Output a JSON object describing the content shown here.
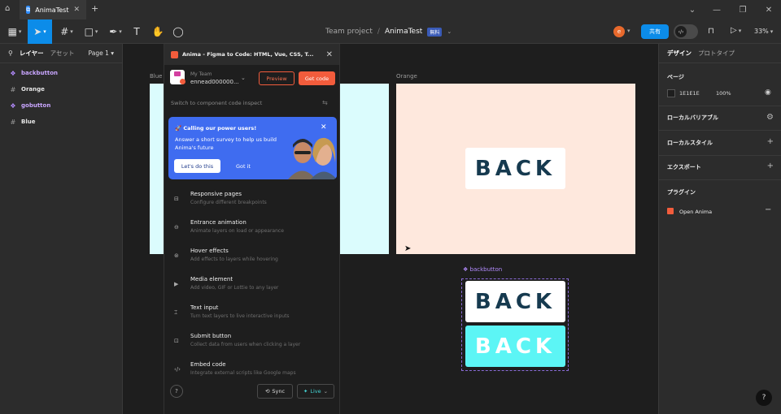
{
  "window": {
    "tab_title": "AnimaTest",
    "controls": [
      "minimize",
      "restore",
      "close"
    ]
  },
  "toolbar": {
    "breadcrumb_project": "Team project",
    "breadcrumb_sep": "/",
    "breadcrumb_file": "AnimaTest",
    "plan_badge": "無料",
    "avatar_initial": "e",
    "share_label": "共有",
    "zoom": "33%"
  },
  "left_panel": {
    "tab_layers": "レイヤー",
    "tab_assets": "アセット",
    "page": "Page 1",
    "layers": [
      {
        "name": "backbutton",
        "type": "component"
      },
      {
        "name": "Orange",
        "type": "frame"
      },
      {
        "name": "gobutton",
        "type": "component"
      },
      {
        "name": "Blue",
        "type": "frame"
      }
    ]
  },
  "canvas": {
    "frame_blue_label": "Blue",
    "frame_orange_label": "Orange",
    "component_label": "backbutton",
    "button_text": "BACK",
    "colors": {
      "blue_frame": "#dbfcfd",
      "orange_frame": "#fee8dd",
      "back_text": "#163a4f",
      "back_cyan": "#5cf5f5"
    }
  },
  "plugin": {
    "title": "Anima - Figma to Code: HTML, Vue, CSS, T...",
    "team_label": "My Team",
    "team_user": "ennead000000...",
    "preview_label": "Preview",
    "getcode_label": "Get code",
    "switch_text": "Switch to component code inspect",
    "promo": {
      "title": "Calling our power users!",
      "body": "Answer a short survey to help us build Anima's future",
      "primary": "Let's do this",
      "secondary": "Got it"
    },
    "features": [
      {
        "title": "Responsive pages",
        "desc": "Configure different breakpoints",
        "icon": "responsive-icon"
      },
      {
        "title": "Entrance animation",
        "desc": "Animate layers on load or appearance",
        "icon": "animation-icon"
      },
      {
        "title": "Hover effects",
        "desc": "Add effects to layers while hovering",
        "icon": "hover-icon"
      },
      {
        "title": "Media element",
        "desc": "Add video, GIF or Lottie to any layer",
        "icon": "media-icon"
      },
      {
        "title": "Text input",
        "desc": "Turn text layers to live interactive inputs",
        "icon": "text-input-icon"
      },
      {
        "title": "Submit button",
        "desc": "Collect data from users when clicking a layer",
        "icon": "submit-icon"
      },
      {
        "title": "Embed code",
        "desc": "Integrate external scripts like Google maps",
        "icon": "embed-icon"
      }
    ],
    "help": "?",
    "sync_label": "Sync",
    "live_label": "Live"
  },
  "right_panel": {
    "tab_design": "デザイン",
    "tab_prototype": "プロトタイプ",
    "page_section": "ページ",
    "page_color": "1E1E1E",
    "page_opacity": "100%",
    "local_variables": "ローカルバリアブル",
    "local_styles": "ローカルスタイル",
    "export": "エクスポート",
    "plugins": "プラグイン",
    "open_anima": "Open Anima"
  },
  "help_fab": "?"
}
